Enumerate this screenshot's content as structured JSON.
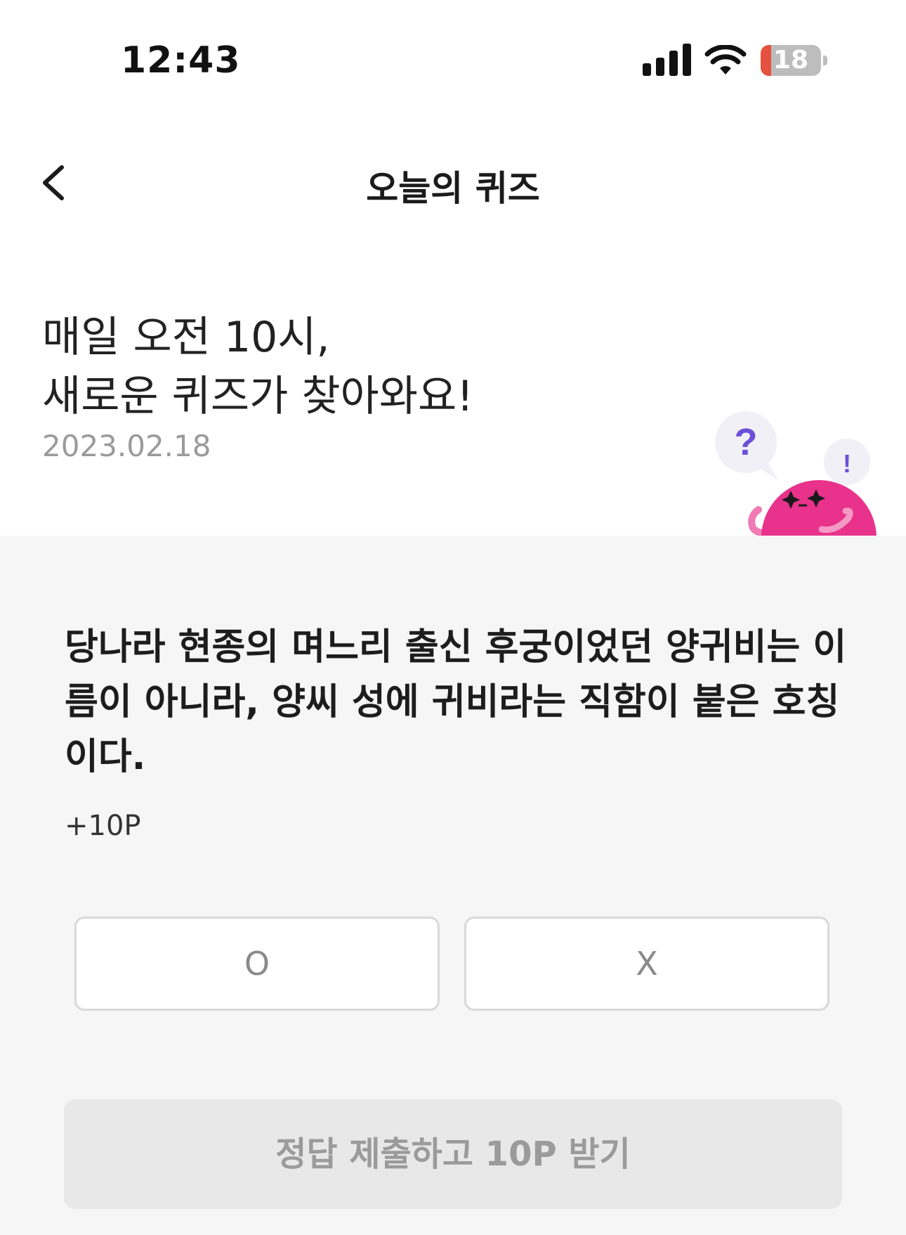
{
  "status_bar": {
    "time": "12:43",
    "battery_level": "18",
    "battery_fraction": 0.18,
    "battery_color": "#e5523f",
    "icons": [
      "signal-icon",
      "wifi-icon",
      "battery-icon"
    ]
  },
  "nav": {
    "back_icon": "chevron-left-icon",
    "title": "오늘의 퀴즈"
  },
  "hero": {
    "headline_line1": "매일 오전 10시,",
    "headline_line2": "새로운 퀴즈가 찾아와요!",
    "date": "2023.02.18",
    "mascot": {
      "question_mark": "?",
      "exclamation_mark": "!",
      "color": "#e8328b"
    }
  },
  "quiz": {
    "question": "당나라 현종의 며느리 출신 후궁이었던 양귀비는 이름이 아니라, 양씨 성에 귀비라는 직함이 붙은 호칭이다.",
    "reward": "+10P",
    "options": {
      "o": "O",
      "x": "X"
    },
    "submit_label": "정답 제출하고 10P 받기"
  },
  "colors": {
    "panel_background": "#f6f6f6",
    "submit_disabled_background": "#e8e8e8",
    "accent_purple": "#6b4fd8"
  }
}
